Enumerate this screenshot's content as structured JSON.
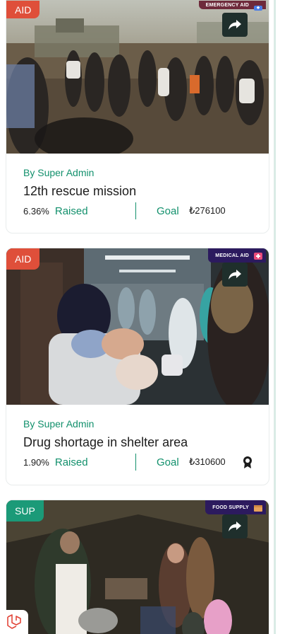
{
  "colors": {
    "accent": "#12906c",
    "aid_badge": "#df4f3a",
    "sup_badge": "#1b9a78",
    "tag_bg": "#2c1a5e",
    "share_btn": "#1f2f2c"
  },
  "cards": [
    {
      "category": "AID",
      "tag": "EMERGENCY AID",
      "author": "By Super Admin",
      "title": "12th rescue mission",
      "raised_percent": "6.36%",
      "raised_label": "Raised",
      "goal_label": "Goal",
      "goal_value": "₺276100",
      "share_icon": "share-icon"
    },
    {
      "category": "AID",
      "tag": "MEDICAL AID",
      "author": "By Super Admin",
      "title": "Drug shortage in shelter area",
      "raised_percent": "1.90%",
      "raised_label": "Raised",
      "goal_label": "Goal",
      "goal_value": "₺310600",
      "share_icon": "share-icon",
      "badge_icon": "medal-icon"
    },
    {
      "category": "SUP",
      "tag": "FOOD SUPPLY",
      "share_icon": "share-icon"
    }
  ],
  "fab_icon": "laravel-icon"
}
